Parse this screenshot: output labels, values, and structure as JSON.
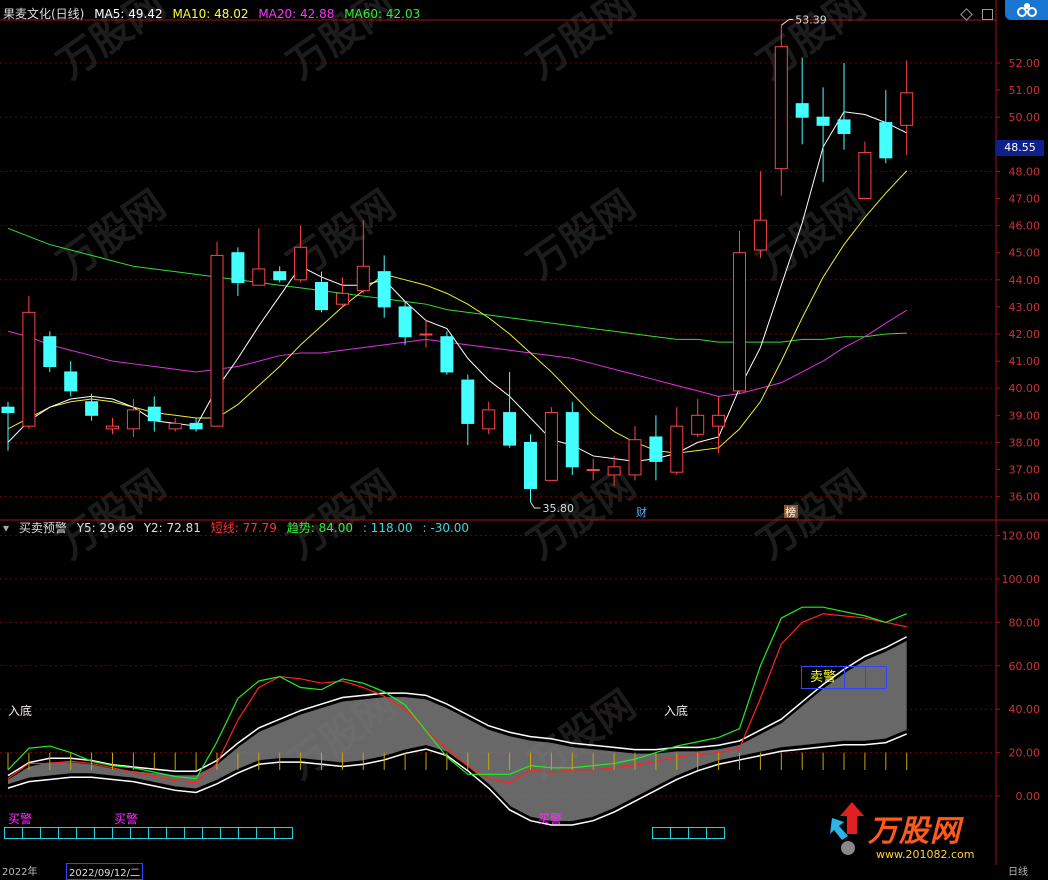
{
  "header": {
    "stock_name": "果麦文化(日线)",
    "ma": [
      {
        "label": "MA5: 49.42",
        "color": "#ffffff"
      },
      {
        "label": "MA10: 48.02",
        "color": "#ffff33"
      },
      {
        "label": "MA20: 42.88",
        "color": "#ff33ff"
      },
      {
        "label": "MA60: 42.03",
        "color": "#33ee33"
      }
    ]
  },
  "price_axis": [
    "52.00",
    "51.00",
    "50.00",
    "49.00",
    "48.00",
    "47.00",
    "46.00",
    "45.00",
    "44.00",
    "43.00",
    "42.00",
    "41.00",
    "40.00",
    "39.00",
    "38.00",
    "37.00",
    "36.00"
  ],
  "current_price": "48.55",
  "high_label": "53.39",
  "low_label": "35.80",
  "markers": {
    "cai": "财",
    "bang": "榜"
  },
  "indicator": {
    "title": "买卖预警",
    "values": [
      {
        "label": "Y5: 29.69",
        "color": "#dddddd"
      },
      {
        "label": "Y2: 72.81",
        "color": "#dddddd"
      },
      {
        "label": "短线: 77.79",
        "color": "#ff3333"
      },
      {
        "label": "趋势: 84.00",
        "color": "#33ee33"
      },
      {
        "label": ": 118.00",
        "color": "#33dddd"
      },
      {
        "label": ": -30.00",
        "color": "#33dddd"
      }
    ],
    "axis": [
      "120.00",
      "100.00",
      "80.00",
      "60.00",
      "40.00",
      "20.00",
      "0.00"
    ],
    "ru_di_1": "入底",
    "ru_di_2": "入底",
    "mai_jing": "买警",
    "sell_label": "卖警"
  },
  "brand": {
    "name": "万股网",
    "url": "www.201082.com"
  },
  "bottom": {
    "left1": "2022年",
    "date": "2022/09/12/二",
    "right": "日线"
  },
  "chart_data": {
    "type": "candlestick",
    "title": "果麦文化(日线)",
    "ylim": [
      35.5,
      53.5
    ],
    "candles": [
      {
        "o": 39.3,
        "c": 39.1,
        "h": 39.5,
        "l": 37.7
      },
      {
        "o": 38.6,
        "c": 42.8,
        "h": 43.4,
        "l": 38.5
      },
      {
        "o": 41.9,
        "c": 40.8,
        "h": 42.1,
        "l": 40.6
      },
      {
        "o": 40.6,
        "c": 39.9,
        "h": 41.0,
        "l": 39.7
      },
      {
        "o": 39.5,
        "c": 39.0,
        "h": 39.8,
        "l": 38.8
      },
      {
        "o": 38.5,
        "c": 38.6,
        "h": 38.9,
        "l": 38.3
      },
      {
        "o": 38.5,
        "c": 39.2,
        "h": 39.6,
        "l": 38.2
      },
      {
        "o": 39.3,
        "c": 38.8,
        "h": 39.7,
        "l": 38.4
      },
      {
        "o": 38.5,
        "c": 38.7,
        "h": 38.9,
        "l": 38.4
      },
      {
        "o": 38.7,
        "c": 38.5,
        "h": 38.9,
        "l": 38.4
      },
      {
        "o": 38.6,
        "c": 44.9,
        "h": 45.4,
        "l": 38.6
      },
      {
        "o": 45.0,
        "c": 43.9,
        "h": 45.2,
        "l": 43.4
      },
      {
        "o": 43.8,
        "c": 44.4,
        "h": 45.9,
        "l": 43.8
      },
      {
        "o": 44.3,
        "c": 44.0,
        "h": 44.5,
        "l": 43.9
      },
      {
        "o": 44.0,
        "c": 45.2,
        "h": 46.0,
        "l": 43.9
      },
      {
        "o": 43.9,
        "c": 42.9,
        "h": 44.3,
        "l": 42.8
      },
      {
        "o": 43.1,
        "c": 43.5,
        "h": 44.1,
        "l": 43.0
      },
      {
        "o": 43.6,
        "c": 44.5,
        "h": 46.2,
        "l": 43.5
      },
      {
        "o": 44.3,
        "c": 43.0,
        "h": 44.9,
        "l": 42.6
      },
      {
        "o": 43.0,
        "c": 41.9,
        "h": 43.2,
        "l": 41.6
      },
      {
        "o": 42.0,
        "c": 42.0,
        "h": 42.5,
        "l": 41.5
      },
      {
        "o": 41.9,
        "c": 40.6,
        "h": 42.1,
        "l": 40.5
      },
      {
        "o": 40.3,
        "c": 38.7,
        "h": 40.5,
        "l": 37.9
      },
      {
        "o": 38.5,
        "c": 39.2,
        "h": 39.5,
        "l": 38.3
      },
      {
        "o": 39.1,
        "c": 37.9,
        "h": 40.6,
        "l": 37.8
      },
      {
        "o": 38.0,
        "c": 36.3,
        "h": 38.3,
        "l": 35.8
      },
      {
        "o": 36.6,
        "c": 39.1,
        "h": 39.3,
        "l": 36.6
      },
      {
        "o": 39.1,
        "c": 37.1,
        "h": 39.5,
        "l": 36.8
      },
      {
        "o": 37.0,
        "c": 37.0,
        "h": 37.4,
        "l": 36.6
      },
      {
        "o": 36.8,
        "c": 37.1,
        "h": 37.5,
        "l": 36.4
      },
      {
        "o": 36.8,
        "c": 38.1,
        "h": 38.6,
        "l": 36.6
      },
      {
        "o": 38.2,
        "c": 37.3,
        "h": 39.0,
        "l": 36.6
      },
      {
        "o": 36.9,
        "c": 38.6,
        "h": 39.3,
        "l": 36.8
      },
      {
        "o": 38.3,
        "c": 39.0,
        "h": 39.6,
        "l": 38.2
      },
      {
        "o": 38.6,
        "c": 39.0,
        "h": 39.7,
        "l": 37.6
      },
      {
        "o": 39.9,
        "c": 45.0,
        "h": 45.8,
        "l": 39.8
      },
      {
        "o": 45.1,
        "c": 46.2,
        "h": 48.0,
        "l": 44.8
      },
      {
        "o": 48.1,
        "c": 52.6,
        "h": 53.39,
        "l": 47.1
      },
      {
        "o": 50.5,
        "c": 50.0,
        "h": 52.2,
        "l": 49.0
      },
      {
        "o": 50.0,
        "c": 49.7,
        "h": 51.1,
        "l": 47.6
      },
      {
        "o": 49.9,
        "c": 49.4,
        "h": 52.0,
        "l": 48.8
      },
      {
        "o": 47.0,
        "c": 48.7,
        "h": 49.1,
        "l": 47.0
      },
      {
        "o": 49.8,
        "c": 48.5,
        "h": 51.0,
        "l": 48.3
      },
      {
        "o": 49.7,
        "c": 50.9,
        "h": 52.1,
        "l": 48.6
      }
    ],
    "ma5": [
      38.0,
      38.8,
      39.3,
      39.6,
      39.7,
      39.6,
      39.3,
      38.8,
      38.7,
      38.6,
      40.0,
      41.1,
      42.3,
      43.4,
      44.5,
      44.1,
      43.8,
      43.8,
      44.0,
      43.2,
      42.5,
      42.2,
      41.1,
      40.3,
      39.7,
      38.9,
      38.1,
      37.9,
      37.5,
      37.4,
      37.3,
      37.4,
      37.6,
      38.0,
      38.2,
      40.0,
      41.5,
      43.8,
      46.1,
      48.9,
      50.2,
      50.1,
      49.8,
      49.42
    ],
    "ma10": [
      38.5,
      38.9,
      39.3,
      39.5,
      39.6,
      39.5,
      39.3,
      39.1,
      39.0,
      38.9,
      38.9,
      39.4,
      40.1,
      40.8,
      41.6,
      42.3,
      43.0,
      43.6,
      44.2,
      44.0,
      43.8,
      43.5,
      43.1,
      42.6,
      42.0,
      41.3,
      40.6,
      39.8,
      39.0,
      38.4,
      38.0,
      37.7,
      37.6,
      37.7,
      37.8,
      38.5,
      39.5,
      41.0,
      42.6,
      44.1,
      45.3,
      46.3,
      47.2,
      48.02
    ],
    "ma20": [
      42.1,
      41.9,
      41.6,
      41.4,
      41.2,
      41.0,
      40.9,
      40.8,
      40.7,
      40.6,
      40.7,
      40.8,
      41.0,
      41.2,
      41.3,
      41.3,
      41.4,
      41.5,
      41.6,
      41.7,
      41.8,
      41.7,
      41.6,
      41.5,
      41.4,
      41.3,
      41.2,
      41.1,
      40.9,
      40.7,
      40.5,
      40.3,
      40.1,
      39.9,
      39.7,
      39.8,
      40.0,
      40.2,
      40.6,
      41.0,
      41.5,
      41.9,
      42.4,
      42.88
    ],
    "ma60": [
      45.9,
      45.6,
      45.3,
      45.1,
      44.9,
      44.7,
      44.5,
      44.4,
      44.3,
      44.2,
      44.1,
      44.0,
      43.9,
      43.8,
      43.7,
      43.6,
      43.5,
      43.4,
      43.3,
      43.2,
      43.1,
      42.9,
      42.8,
      42.7,
      42.6,
      42.5,
      42.4,
      42.3,
      42.2,
      42.1,
      42.0,
      41.9,
      41.8,
      41.8,
      41.7,
      41.7,
      41.7,
      41.7,
      41.8,
      41.8,
      41.9,
      41.9,
      42.0,
      42.03
    ],
    "osc_ylim": [
      -10,
      125
    ],
    "osc_short": [
      8,
      15,
      15,
      16,
      15,
      13,
      11,
      9,
      7,
      6,
      15,
      35,
      50,
      55,
      54,
      52,
      53,
      50,
      46,
      40,
      30,
      22,
      14,
      8,
      6,
      12,
      11,
      12,
      12,
      13,
      14,
      16,
      18,
      19,
      20,
      22,
      45,
      70,
      80,
      84,
      83,
      82,
      80,
      78
    ],
    "osc_trend": [
      12,
      22,
      23,
      20,
      16,
      14,
      13,
      11,
      9,
      8,
      25,
      45,
      53,
      55,
      50,
      49,
      54,
      52,
      48,
      42,
      30,
      18,
      10,
      10,
      10,
      14,
      13,
      13,
      14,
      15,
      17,
      20,
      23,
      25,
      27,
      31,
      60,
      82,
      87,
      87,
      85,
      83,
      80,
      84
    ],
    "osc_upper": [
      8,
      14,
      16,
      16,
      15,
      13,
      12,
      11,
      10,
      10,
      15,
      23,
      30,
      34,
      38,
      41,
      44,
      45,
      46,
      46,
      45,
      41,
      36,
      31,
      28,
      26,
      25,
      23,
      22,
      21,
      20,
      20,
      21,
      21,
      22,
      24,
      29,
      34,
      42,
      50,
      57,
      63,
      67,
      72
    ],
    "osc_lower": [
      5,
      8,
      9,
      10,
      10,
      9,
      8,
      6,
      4,
      3,
      7,
      12,
      16,
      17,
      17,
      16,
      15,
      16,
      18,
      21,
      23,
      20,
      13,
      5,
      -5,
      -10,
      -12,
      -12,
      -10,
      -6,
      -1,
      4,
      9,
      13,
      16,
      18,
      20,
      22,
      23,
      24,
      25,
      25,
      26,
      30
    ]
  }
}
